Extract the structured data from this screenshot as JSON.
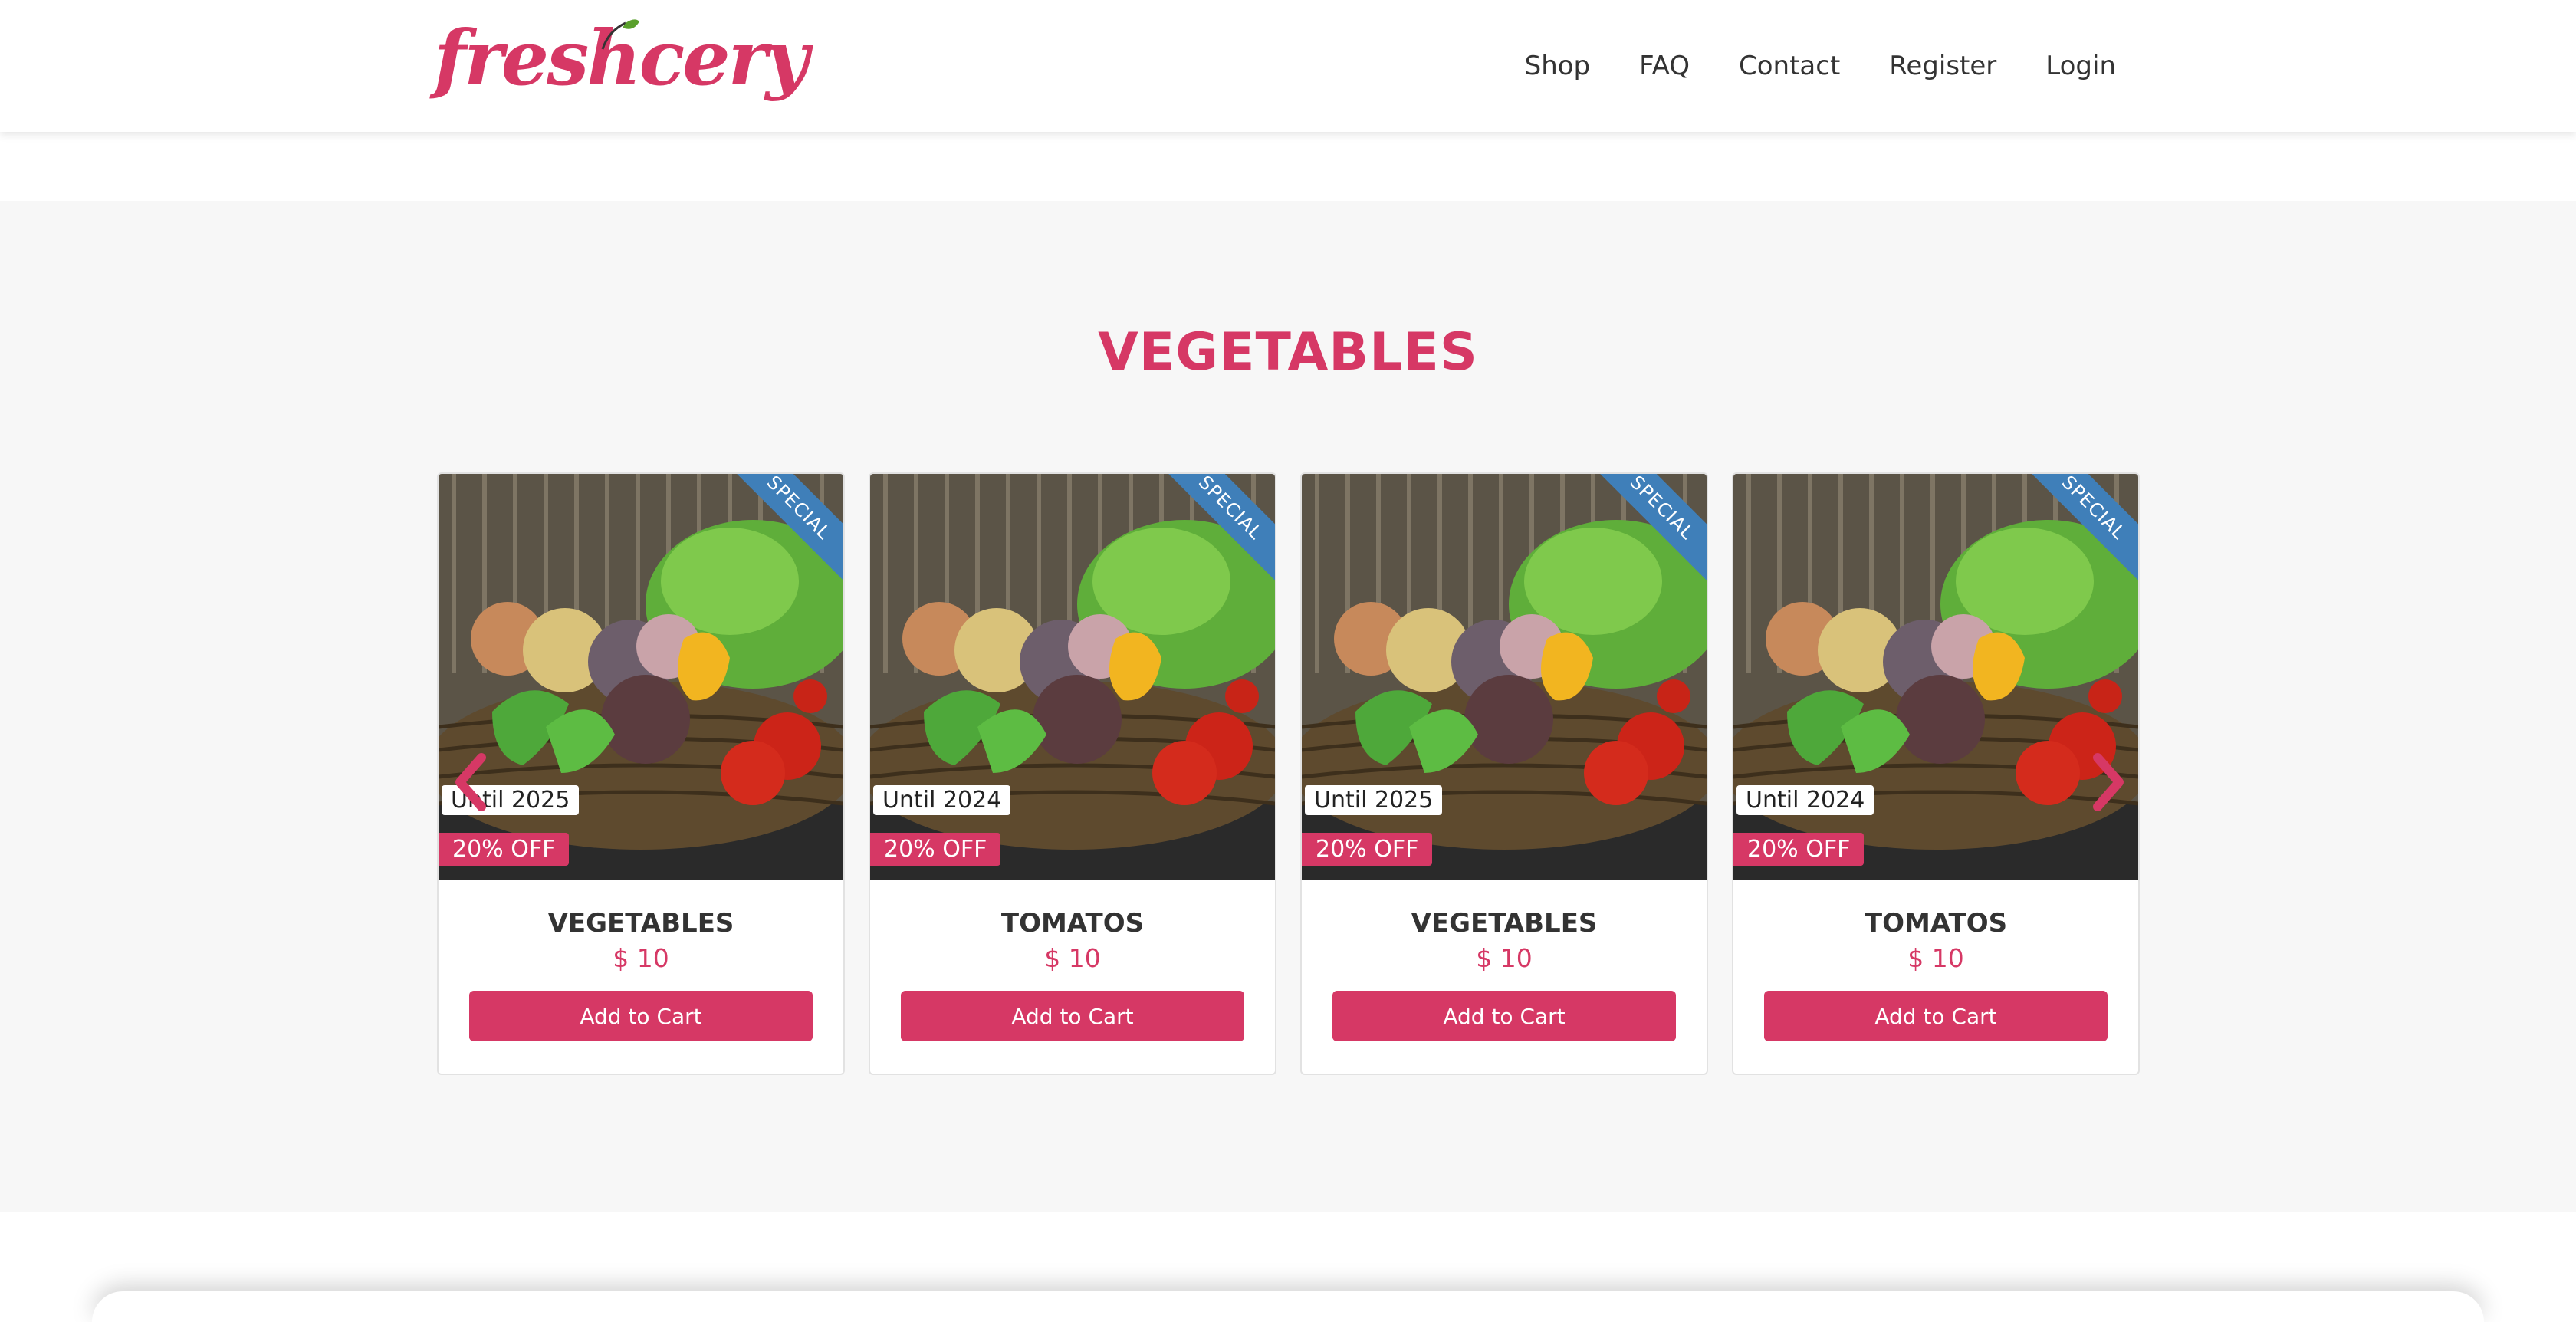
{
  "brand": {
    "logo_text": "freshcery",
    "accent": "#d63865",
    "ribbon_color": "#3f7fb9"
  },
  "nav": {
    "items": [
      "Shop",
      "FAQ",
      "Contact",
      "Register",
      "Login"
    ]
  },
  "section": {
    "title": "VEGETABLES"
  },
  "carousel": {
    "prev_icon": "chevron-left-icon",
    "next_icon": "chevron-right-icon",
    "products": [
      {
        "ribbon": "SPECIAL",
        "until": "Until 2025",
        "discount": "20% OFF",
        "name": "VEGETABLES",
        "price": "$ 10",
        "button": "Add to Cart"
      },
      {
        "ribbon": "SPECIAL",
        "until": "Until 2024",
        "discount": "20% OFF",
        "name": "TOMATOS",
        "price": "$ 10",
        "button": "Add to Cart"
      },
      {
        "ribbon": "SPECIAL",
        "until": "Until 2025",
        "discount": "20% OFF",
        "name": "VEGETABLES",
        "price": "$ 10",
        "button": "Add to Cart"
      },
      {
        "ribbon": "SPECIAL",
        "until": "Until 2024",
        "discount": "20% OFF",
        "name": "TOMATOS",
        "price": "$ 10",
        "button": "Add to Cart"
      }
    ]
  }
}
